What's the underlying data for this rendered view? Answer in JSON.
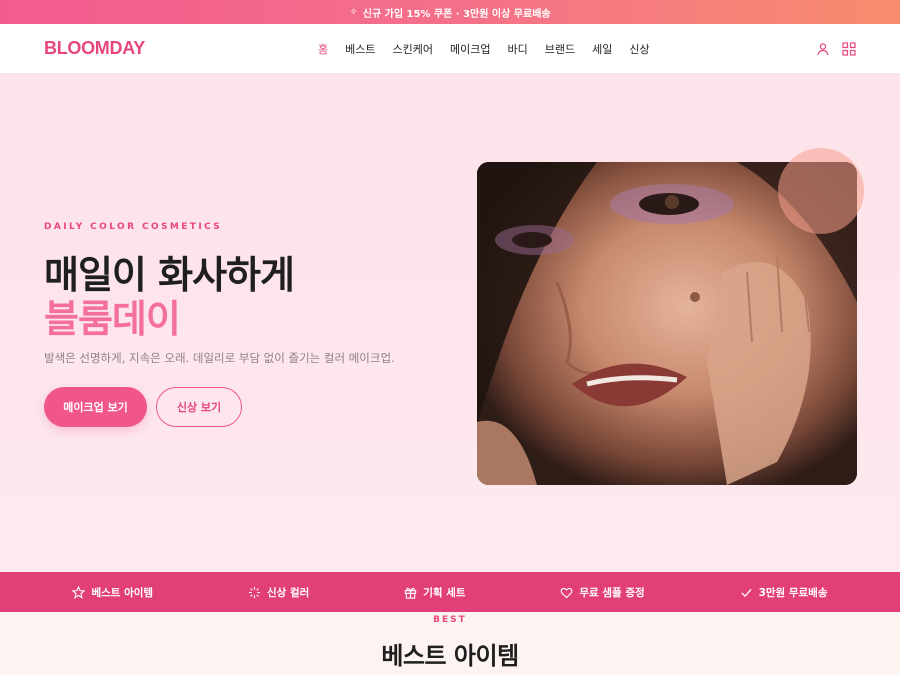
{
  "promo": {
    "text": "신규 가입 15% 쿠폰 · 3만원 이상 무료배송"
  },
  "brand": {
    "logo": "BLOOMDAY",
    "accent": "#e8467f"
  },
  "nav": {
    "items": [
      "홈",
      "베스트",
      "스킨케어",
      "메이크업",
      "바디",
      "브랜드",
      "세일",
      "신상"
    ],
    "active_index": 0
  },
  "hero": {
    "eyebrow": "DAILY COLOR COSMETICS",
    "title_line1": "매일이 화사하게",
    "title_line2": "블룸데이",
    "description": "발색은 선명하게, 지속은 오래. 데일리로 부담 없이 즐기는 컬러 메이크업.",
    "primary_button": "메이크업 보기",
    "secondary_button": "신상 보기"
  },
  "features": [
    {
      "icon": "star-icon",
      "label": "베스트 아이템"
    },
    {
      "icon": "sparkle-icon",
      "label": "신상 컬러"
    },
    {
      "icon": "gift-icon",
      "label": "기획 세트"
    },
    {
      "icon": "heart-icon",
      "label": "무료 샘플 증정"
    },
    {
      "icon": "check-icon",
      "label": "3만원 무료배송"
    }
  ],
  "best_section": {
    "eyebrow": "BEST",
    "title": "베스트 아이템"
  }
}
